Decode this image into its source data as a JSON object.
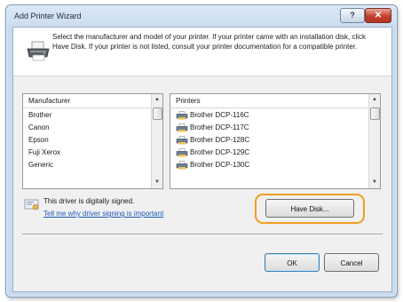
{
  "window": {
    "title": "Add Printer Wizard",
    "help_glyph": "?",
    "close_glyph": "✕"
  },
  "header": {
    "instructions": "Select the manufacturer and model of your printer. If your printer came with an installation disk, click Have Disk. If your printer is not listed, consult your printer documentation for a compatible printer."
  },
  "manufacturer_list": {
    "header": "Manufacturer",
    "items": [
      "Brother",
      "Canon",
      "Epson",
      "Fuji Xerox",
      "Generic"
    ],
    "selected": "Brother"
  },
  "printers_list": {
    "header": "Printers",
    "items": [
      "Brother DCP-116C",
      "Brother DCP-117C",
      "Brother DCP-128C",
      "Brother DCP-129C",
      "Brother DCP-130C"
    ],
    "selected": "Brother DCP-116C"
  },
  "signing": {
    "status": "This driver is digitally signed.",
    "link": "Tell me why driver signing is important"
  },
  "buttons": {
    "have_disk": "Have Disk...",
    "ok": "OK",
    "cancel": "Cancel"
  },
  "colors": {
    "highlight_ring": "#f0a020",
    "link": "#1c5bb8",
    "title_bar": "#c9dcef"
  },
  "icons": [
    "printer-icon",
    "mini-printer-icon",
    "certificate-icon",
    "help-icon",
    "close-icon",
    "scroll-up-icon",
    "scroll-down-icon"
  ]
}
